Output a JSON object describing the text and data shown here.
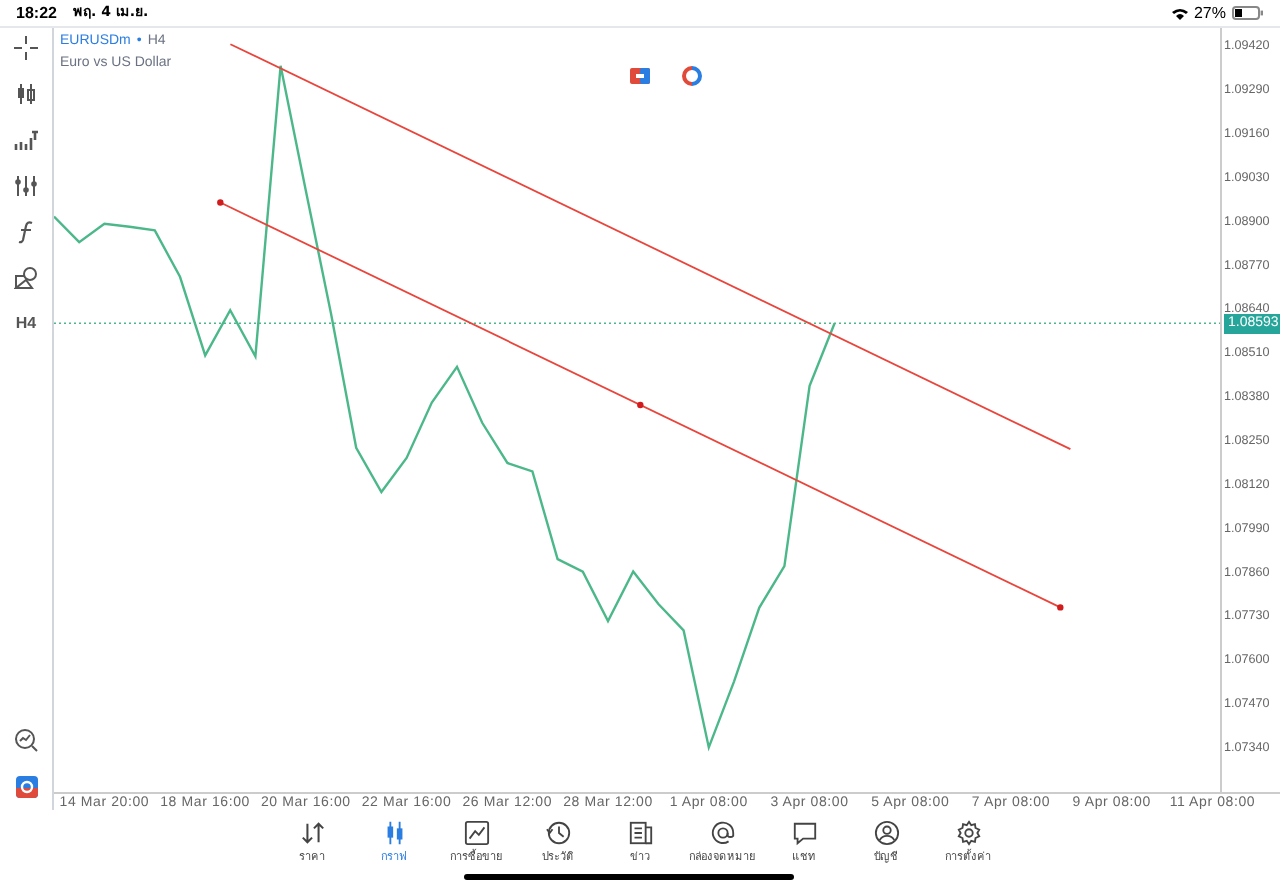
{
  "status_bar": {
    "time": "18:22",
    "date": "พฤ. 4 เม.ย.",
    "battery": "27%"
  },
  "toolbar": {
    "timeframe": "H4"
  },
  "chart": {
    "symbol": "EURUSDm",
    "separator": "•",
    "timeframe": "H4",
    "description": "Euro vs US Dollar",
    "current_price": "1.08593",
    "drawings": [
      {
        "kind": "trendline",
        "handles": false
      },
      {
        "kind": "trendline",
        "handles": true
      }
    ],
    "chart_data": {
      "type": "line",
      "ylim": [
        1.07204,
        1.09468
      ],
      "ref_lines": [
        {
          "axis": "y",
          "value": 1.08593,
          "color": "#4cb88a"
        }
      ],
      "categories": [
        null,
        null,
        "14 Mar 20:00",
        null,
        null,
        null,
        "18 Mar 16:00",
        null,
        null,
        null,
        "20 Mar 16:00",
        null,
        null,
        null,
        "22 Mar 16:00",
        null,
        null,
        null,
        "26 Mar 12:00",
        null,
        null,
        null,
        "28 Mar 12:00",
        null,
        null,
        null,
        "1 Apr 08:00",
        null,
        null,
        null,
        "3 Apr 08:00",
        null,
        null,
        null,
        "5 Apr 08:00",
        null,
        null,
        null,
        "7 Apr 08:00",
        null,
        null,
        null,
        "9 Apr 08:00",
        null,
        null,
        null,
        "11 Apr 08:00"
      ],
      "yticks": [
        {
          "value": 1.0942,
          "label": "1.09420"
        },
        {
          "value": 1.0929,
          "label": "1.09290"
        },
        {
          "value": 1.0916,
          "label": "1.09160"
        },
        {
          "value": 1.0903,
          "label": "1.09030"
        },
        {
          "value": 1.089,
          "label": "1.08900"
        },
        {
          "value": 1.0877,
          "label": "1.08770"
        },
        {
          "value": 1.0864,
          "label": "1.08640"
        },
        {
          "value": 1.0851,
          "label": "1.08510"
        },
        {
          "value": 1.0838,
          "label": "1.08380"
        },
        {
          "value": 1.0825,
          "label": "1.08250"
        },
        {
          "value": 1.0812,
          "label": "1.08120"
        },
        {
          "value": 1.0799,
          "label": "1.07990"
        },
        {
          "value": 1.0786,
          "label": "1.07860"
        },
        {
          "value": 1.0773,
          "label": "1.07730"
        },
        {
          "value": 1.076,
          "label": "1.07600"
        },
        {
          "value": 1.0747,
          "label": "1.07470"
        },
        {
          "value": 1.0734,
          "label": "1.07340"
        }
      ],
      "series": [
        {
          "color": "#4cb88a",
          "values": [
            1.08909,
            1.08833,
            1.08888,
            1.08879,
            1.08868,
            1.08731,
            1.08498,
            1.08632,
            1.08495,
            1.09356,
            1.08986,
            1.08622,
            1.08224,
            1.08093,
            1.08194,
            1.08358,
            1.08464,
            1.08298,
            1.08179,
            1.08154,
            1.07894,
            1.07857,
            1.07711,
            1.07858,
            1.07761,
            1.07683,
            1.07336,
            1.07531,
            1.0775,
            1.07873,
            1.08408,
            1.08593,
            null,
            null,
            null,
            null,
            null,
            null,
            null,
            null,
            null,
            null,
            null,
            null,
            null,
            null,
            null
          ]
        }
      ]
    }
  },
  "tabs": [
    {
      "label": "ราคา",
      "selected": false
    },
    {
      "label": "กราฟ",
      "selected": true
    },
    {
      "label": "การซื้อขาย",
      "selected": false
    },
    {
      "label": "ประวัติ",
      "selected": false
    },
    {
      "label": "ข่าว",
      "selected": false
    },
    {
      "label": "กล่องจดหมาย",
      "selected": false
    },
    {
      "label": "แชท",
      "selected": false
    },
    {
      "label": "บัญชี",
      "selected": false
    },
    {
      "label": "การตั้งค่า",
      "selected": false
    }
  ]
}
